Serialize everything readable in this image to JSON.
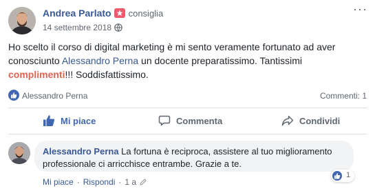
{
  "post": {
    "author": "Andrea Parlato",
    "action": "consiglia",
    "date": "14 settembre 2018",
    "text_part1": "Ho scelto il corso di digital marketing è mi sento veramente fortunato ad aver conosciunto ",
    "mention": "Alessandro Perna",
    "text_part2": " un docente preparatissimo. Tantissimi ",
    "highlight": "complimenti",
    "text_part3": "!!! Soddisfattissimo."
  },
  "reactions": {
    "reactor": "Alessandro Perna",
    "comments_count": "Commenti: 1"
  },
  "actions": {
    "like": "Mi piace",
    "comment": "Commenta",
    "share": "Condividi"
  },
  "comment": {
    "author": "Alessandro Perna",
    "text": " La fortuna è reciproca, assistere al tuo miglioramento professionale ci arricchisce entrambe. Grazie a te.",
    "like_count": "1",
    "like_link": "Mi piace",
    "reply_link": "Rispondi",
    "separator": "·",
    "age": "1 a"
  },
  "colors": {
    "link": "#385898",
    "accent_blue": "#4267b2",
    "highlight": "#e4614e",
    "recommend_badge": "#ec5a6e"
  },
  "icons": [
    "recommend-star-icon",
    "globe-icon",
    "more-options-icon",
    "like-reaction-icon",
    "thumb-up-icon",
    "comment-bubble-icon",
    "share-arrow-icon",
    "edit-pencil-icon"
  ]
}
